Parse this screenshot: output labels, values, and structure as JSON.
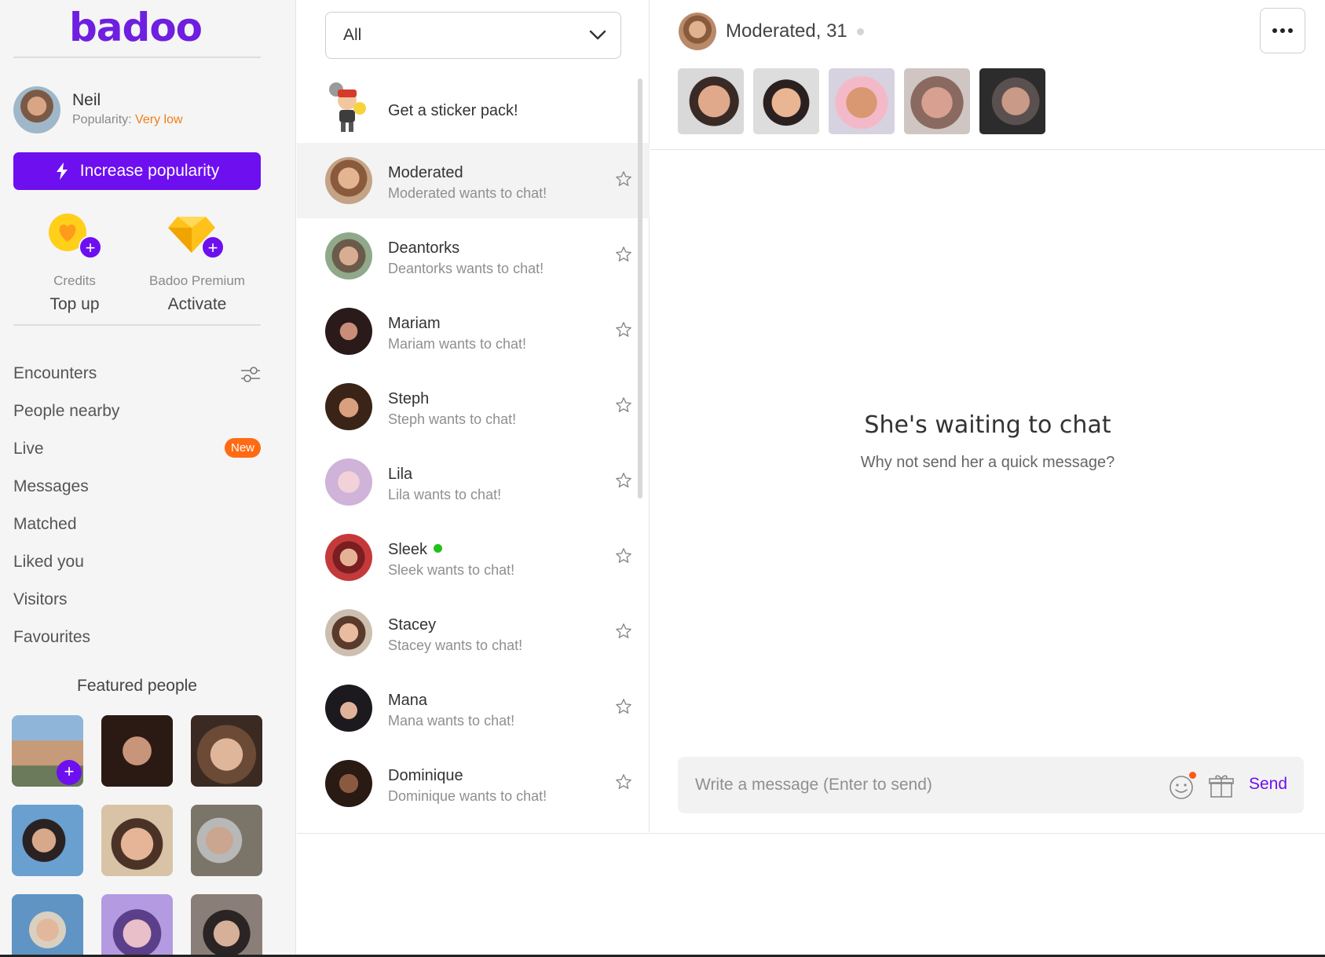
{
  "app": {
    "logo_text": "badoo",
    "brand_color": "#6e0ff0",
    "accent_orange": "#ff6a13"
  },
  "user": {
    "name": "Neil",
    "popularity_label": "Popularity:",
    "popularity_value": "Very low"
  },
  "sidebar": {
    "increase_label": "Increase popularity",
    "credits": {
      "label": "Credits",
      "action": "Top up",
      "icon": "heart-coin-icon"
    },
    "premium": {
      "label": "Badoo Premium",
      "action": "Activate",
      "icon": "diamond-icon"
    },
    "nav": [
      {
        "label": "Encounters",
        "icon": "filter-sliders-icon"
      },
      {
        "label": "People nearby"
      },
      {
        "label": "Live",
        "badge": "New"
      },
      {
        "label": "Messages"
      },
      {
        "label": "Matched"
      },
      {
        "label": "Liked you"
      },
      {
        "label": "Visitors"
      },
      {
        "label": "Favourites"
      }
    ],
    "featured_title": "Featured people"
  },
  "list": {
    "filter_value": "All",
    "sticker_promo": "Get a sticker pack!",
    "conversations": [
      {
        "name": "Moderated",
        "preview": "Moderated wants to chat!",
        "active": true
      },
      {
        "name": "Deantorks",
        "preview": "Deantorks wants to chat!"
      },
      {
        "name": "Mariam",
        "preview": "Mariam wants to chat!"
      },
      {
        "name": "Steph",
        "preview": "Steph wants to chat!"
      },
      {
        "name": "Lila",
        "preview": "Lila wants to chat!"
      },
      {
        "name": "Sleek",
        "preview": "Sleek wants to chat!",
        "online": true
      },
      {
        "name": "Stacey",
        "preview": "Stacey wants to chat!"
      },
      {
        "name": "Mana",
        "preview": "Mana wants to chat!"
      },
      {
        "name": "Dominique",
        "preview": "Dominique wants to chat!"
      }
    ]
  },
  "chat": {
    "header_name": "Moderated, 31",
    "empty_title": "She's waiting to chat",
    "empty_subtitle": "Why not send her a quick message?",
    "composer_placeholder": "Write a message (Enter to send)",
    "send_label": "Send"
  }
}
